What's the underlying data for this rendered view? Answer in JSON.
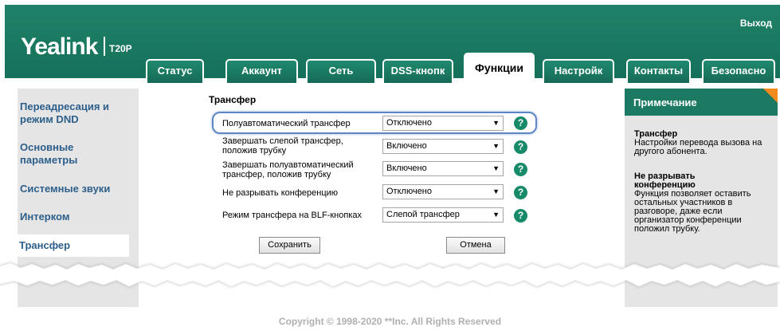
{
  "header": {
    "logo": "Yealink",
    "model": "T20P",
    "logout": "Выход"
  },
  "tabs": [
    {
      "label": "Статус"
    },
    {
      "label": "Аккаунт"
    },
    {
      "label": "Сеть"
    },
    {
      "label": "DSS-кнопк"
    },
    {
      "label": "Функции",
      "active": true
    },
    {
      "label": "Настройк"
    },
    {
      "label": "Контакты"
    },
    {
      "label": "Безопасно"
    }
  ],
  "sidebar": {
    "items": [
      {
        "label_line1": "Переадресация и",
        "label_line2": "режим DND"
      },
      {
        "label_line1": "Основные",
        "label_line2": "параметры"
      },
      {
        "label_line1": "Системные звуки",
        "label_line2": ""
      },
      {
        "label_line1": "Интерком",
        "label_line2": ""
      },
      {
        "label_line1": "Трансфер",
        "label_line2": "",
        "active": true
      }
    ]
  },
  "content": {
    "title": "Трансфер",
    "rows": [
      {
        "label_line1": "Полуавтоматический трансфер",
        "label_line2": "",
        "value": "Отключено"
      },
      {
        "label_line1": "Завершать слепой трансфер,",
        "label_line2": "положив трубку",
        "value": "Включено"
      },
      {
        "label_line1": "Завершать полуавтоматический",
        "label_line2": "трансфер, положив трубку",
        "value": "Включено"
      },
      {
        "label_line1": "Не разрывать конференцию",
        "label_line2": "",
        "value": "Отключено"
      },
      {
        "label_line1": "Режим трансфера на BLF-кнопках",
        "label_line2": "",
        "value": "Слепой трансфер"
      }
    ],
    "help_glyph": "?",
    "save_label": "Сохранить",
    "cancel_label": "Отмена"
  },
  "note": {
    "header": "Примечание",
    "sections": [
      {
        "title": "Трансфер",
        "lines": [
          "Настройки перевода вызова на",
          "другого абонента."
        ]
      },
      {
        "title_line1": "Не разрывать",
        "title_line2": "конференцию",
        "lines": [
          "Функция позволяет оставить",
          "остальных участников в",
          "разговоре, даже если",
          "организатор конференции",
          "положил трубку."
        ]
      }
    ]
  },
  "footer": {
    "copyright": "Copyright © 1998-2020 **Inc. All Rights Reserved"
  },
  "colors": {
    "header_green": "#1c7a63",
    "panel_gray": "#e5e5e5",
    "link_blue": "#2d5f8a",
    "help_green": "#178a6a",
    "corner_orange": "#f08a1c",
    "highlight_blue": "#5d86c4"
  },
  "icons": {
    "select_arrow": "dropdown-arrow-icon",
    "help": "help-icon"
  }
}
